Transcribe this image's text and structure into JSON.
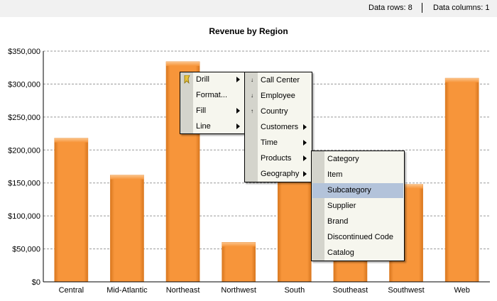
{
  "status": {
    "data_rows": "Data rows: 8",
    "data_columns": "Data columns: 1"
  },
  "chart_data": {
    "type": "bar",
    "title": "Revenue by Region",
    "categories": [
      "Central",
      "Mid-Atlantic",
      "Northeast",
      "Northwest",
      "South",
      "Southeast",
      "Southwest",
      "Web"
    ],
    "values": [
      218000,
      162000,
      334000,
      60000,
      158000,
      40000,
      148000,
      309000
    ],
    "ylim": [
      0,
      350000
    ],
    "yticks": [
      "$0",
      "$50,000",
      "$100,000",
      "$150,000",
      "$200,000",
      "$250,000",
      "$300,000",
      "$350,000"
    ],
    "grid": true,
    "color": "#f7953a"
  },
  "menu_main": [
    {
      "label": "Drill",
      "submenu": true,
      "icon": "drill-icon"
    },
    {
      "label": "Format...",
      "submenu": false
    },
    {
      "label": "Fill",
      "submenu": true
    },
    {
      "label": "Line",
      "submenu": true
    }
  ],
  "menu_drill": [
    {
      "label": "Call Center",
      "submenu": false,
      "icon": "↓"
    },
    {
      "label": "Employee",
      "submenu": false,
      "icon": "↓"
    },
    {
      "label": "Country",
      "submenu": false,
      "icon": "↑"
    },
    {
      "label": "Customers",
      "submenu": true
    },
    {
      "label": "Time",
      "submenu": true
    },
    {
      "label": "Products",
      "submenu": true
    },
    {
      "label": "Geography",
      "submenu": true
    }
  ],
  "menu_products": [
    {
      "label": "Category"
    },
    {
      "label": "Item"
    },
    {
      "label": "Subcategory",
      "selected": true
    },
    {
      "label": "Supplier"
    },
    {
      "label": "Brand"
    },
    {
      "label": "Discontinued Code"
    },
    {
      "label": "Catalog"
    }
  ]
}
